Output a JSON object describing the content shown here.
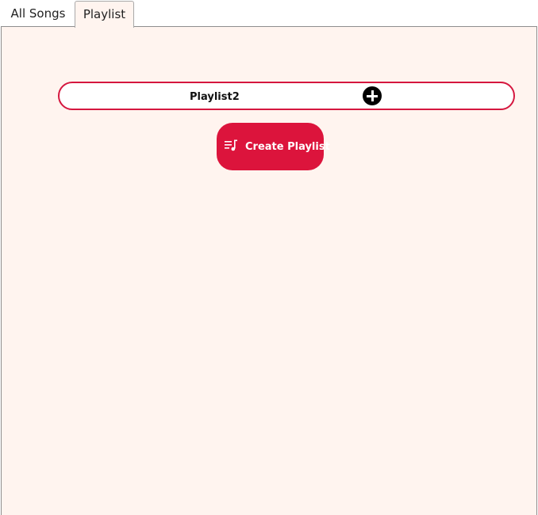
{
  "tabs": [
    {
      "label": "All Songs",
      "selected": false
    },
    {
      "label": "Playlist",
      "selected": true
    }
  ],
  "playlists": [
    {
      "name": "Playlist2",
      "action_icon": "plus-circle-icon"
    }
  ],
  "create_button": {
    "label": "Create Playlist",
    "icon": "playlist-music-icon",
    "color": "#dc143c"
  },
  "colors": {
    "background": "#fff4ef",
    "accent": "#dc143c",
    "row_border": "#d5173f"
  }
}
